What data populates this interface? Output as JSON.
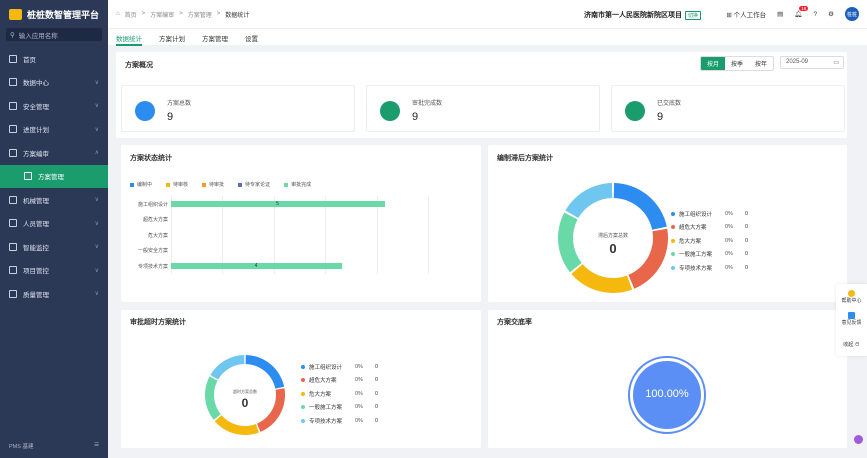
{
  "app": {
    "title": "桩桩数智管理平台"
  },
  "sidebar": {
    "search_placeholder": "输入应用名称",
    "items": [
      {
        "label": "首页",
        "chev": ""
      },
      {
        "label": "数据中心",
        "chev": "∨"
      },
      {
        "label": "安全管理",
        "chev": "∨"
      },
      {
        "label": "进度计划",
        "chev": "∨"
      },
      {
        "label": "方案编审",
        "chev": "∧"
      },
      {
        "label": "方案管理",
        "chev": ""
      },
      {
        "label": "机械管理",
        "chev": "∨"
      },
      {
        "label": "人员管理",
        "chev": "∨"
      },
      {
        "label": "智能监控",
        "chev": "∨"
      },
      {
        "label": "项目管控",
        "chev": "∨"
      },
      {
        "label": "质量管理",
        "chev": "∨"
      }
    ],
    "footer_brand": "PMS 基建"
  },
  "topbar": {
    "breadcrumb": [
      "首页",
      ">",
      "方案编审",
      ">",
      "方案管理",
      ">",
      "数据统计"
    ],
    "project": "济南市第一人民医院新院区项目",
    "project_tag": "切换",
    "workbench": "个人工作台",
    "badge": "18",
    "avatar": "桩桩"
  },
  "tabs": [
    "数据统计",
    "方案计划",
    "方案管理",
    "设置"
  ],
  "overview": {
    "title": "方案概况",
    "toggle": [
      "按月",
      "按季",
      "按年"
    ],
    "date": "2025-09",
    "stats": [
      {
        "label": "方案总数",
        "value": "9",
        "color": "#2d8cf0"
      },
      {
        "label": "审批完成数",
        "value": "9",
        "color": "#1a9c6c"
      },
      {
        "label": "已交底数",
        "value": "9",
        "color": "#1a9c6c"
      }
    ]
  },
  "status_chart": {
    "title": "方案状态统计",
    "legend": [
      {
        "label": "编制中",
        "color": "#2d8cf0"
      },
      {
        "label": "待审核",
        "color": "#f5b80f"
      },
      {
        "label": "待审批",
        "color": "#f59a23"
      },
      {
        "label": "待专家论证",
        "color": "#5b6bbf"
      },
      {
        "label": "审批完成",
        "color": "#6ad9a8"
      }
    ]
  },
  "chart_data": [
    {
      "type": "bar",
      "title": "方案状态统计",
      "categories": [
        "施工组织设计",
        "超危大方案",
        "危大方案",
        "一般安全方案",
        "专项技术方案"
      ],
      "series": [
        {
          "name": "审批完成",
          "values": [
            5,
            0,
            0,
            0,
            4
          ]
        }
      ],
      "xlim": [
        0,
        6
      ]
    },
    {
      "type": "pie",
      "title": "编制滞后方案统计",
      "center_label": "滞后方案总数",
      "center_value": "0",
      "categories": [
        "施工组织设计",
        "超危大方案",
        "危大方案",
        "一般施工方案",
        "专项技术方案"
      ],
      "values": [
        0,
        0,
        0,
        0,
        0
      ],
      "percents": [
        "0%",
        "0%",
        "0%",
        "0%",
        "0%"
      ],
      "colors": [
        "#2d8cf0",
        "#e8664a",
        "#f5b80f",
        "#6ad9a8",
        "#6fc7f0"
      ]
    },
    {
      "type": "pie",
      "title": "审批超时方案统计",
      "center_label": "超时方案总数",
      "center_value": "0",
      "categories": [
        "施工组织设计",
        "超危大方案",
        "危大方案",
        "一般施工方案",
        "专项技术方案"
      ],
      "values": [
        0,
        0,
        0,
        0,
        0
      ],
      "percents": [
        "0%",
        "0%",
        "0%",
        "0%",
        "0%"
      ],
      "colors": [
        "#2d8cf0",
        "#e8664a",
        "#f5b80f",
        "#6ad9a8",
        "#6fc7f0"
      ]
    },
    {
      "type": "gauge",
      "title": "方案交底率",
      "value": 100,
      "label": "100.00%"
    }
  ],
  "float_panel": [
    "帮助中心",
    "意见反馈",
    "收起"
  ]
}
